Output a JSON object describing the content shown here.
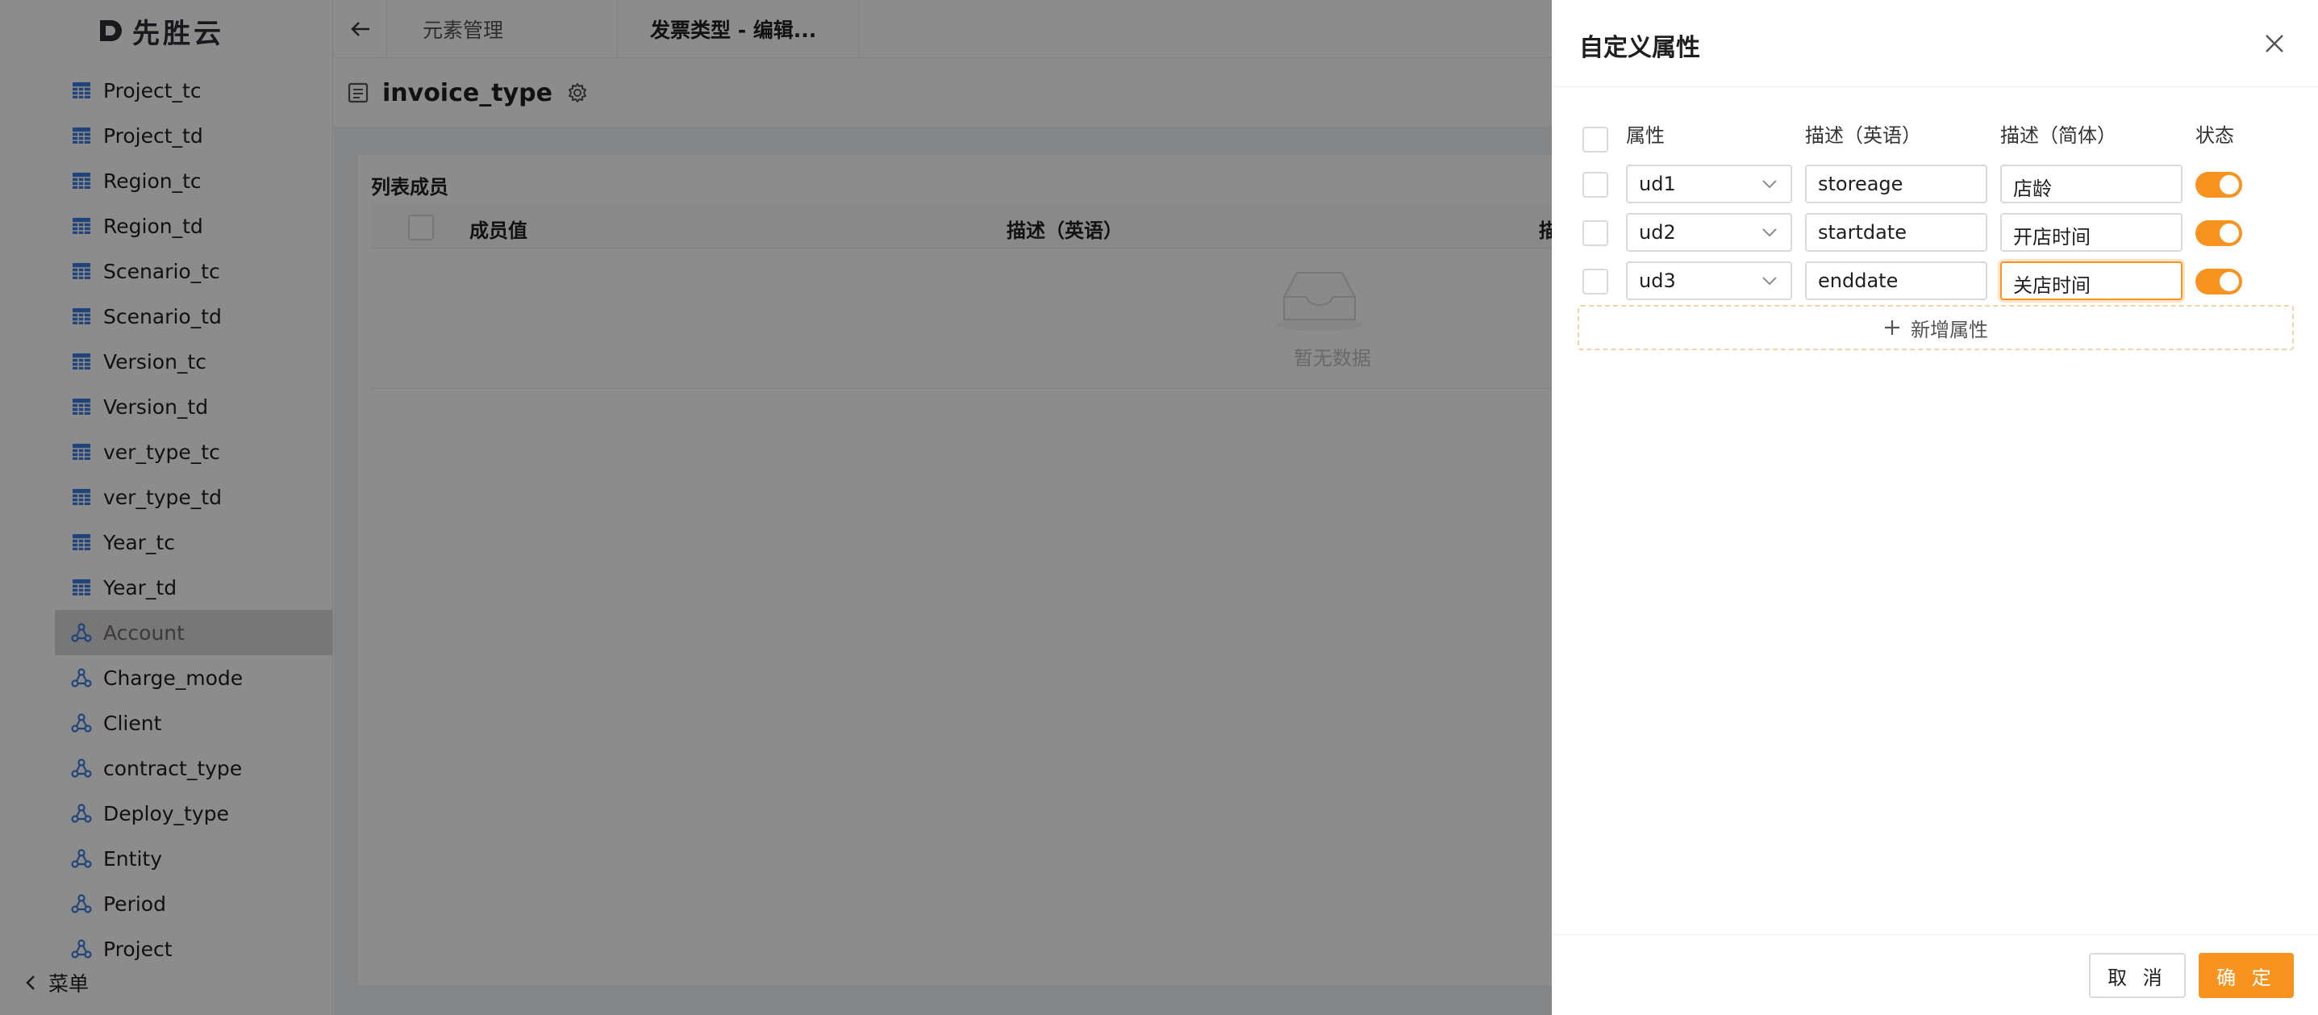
{
  "app": {
    "logo_text": "先胜云",
    "accent_color": "#f7931e"
  },
  "sidebar": {
    "items": [
      {
        "label": "Project_tc",
        "icon": "table-icon"
      },
      {
        "label": "Project_td",
        "icon": "table-icon"
      },
      {
        "label": "Region_tc",
        "icon": "table-icon"
      },
      {
        "label": "Region_td",
        "icon": "table-icon"
      },
      {
        "label": "Scenario_tc",
        "icon": "table-icon"
      },
      {
        "label": "Scenario_td",
        "icon": "table-icon"
      },
      {
        "label": "Version_tc",
        "icon": "table-icon"
      },
      {
        "label": "Version_td",
        "icon": "table-icon"
      },
      {
        "label": "ver_type_tc",
        "icon": "table-icon"
      },
      {
        "label": "ver_type_td",
        "icon": "table-icon"
      },
      {
        "label": "Year_tc",
        "icon": "table-icon"
      },
      {
        "label": "Year_td",
        "icon": "table-icon"
      },
      {
        "label": "Account",
        "icon": "hierarchy-icon",
        "selected": true
      },
      {
        "label": "Charge_mode",
        "icon": "hierarchy-icon"
      },
      {
        "label": "Client",
        "icon": "hierarchy-icon"
      },
      {
        "label": "contract_type",
        "icon": "hierarchy-icon"
      },
      {
        "label": "Deploy_type",
        "icon": "hierarchy-icon"
      },
      {
        "label": "Entity",
        "icon": "hierarchy-icon"
      },
      {
        "label": "Period",
        "icon": "hierarchy-icon"
      },
      {
        "label": "Project",
        "icon": "hierarchy-icon"
      }
    ],
    "footer_label": "菜单"
  },
  "topbar": {
    "tabs": [
      {
        "label": "元素管理"
      },
      {
        "label": "发票类型 - 编辑..."
      }
    ]
  },
  "page": {
    "title": "invoice_type",
    "section_title": "列表成员",
    "columns": [
      "成员值",
      "描述（英语）",
      "描"
    ],
    "empty_text": "暂无数据"
  },
  "drawer": {
    "title": "自定义属性",
    "headers": {
      "attr": "属性",
      "desc_en": "描述（英语）",
      "desc_zh": "描述（简体）",
      "status": "状态"
    },
    "rows": [
      {
        "attr": "ud1",
        "desc_en": "storeage",
        "desc_zh": "店龄",
        "enabled": true
      },
      {
        "attr": "ud2",
        "desc_en": "startdate",
        "desc_zh": "开店时间",
        "enabled": true
      },
      {
        "attr": "ud3",
        "desc_en": "enddate",
        "desc_zh": "关店时间",
        "enabled": true
      }
    ],
    "add_label": "新增属性",
    "cancel_label": "取 消",
    "ok_label": "确 定"
  }
}
